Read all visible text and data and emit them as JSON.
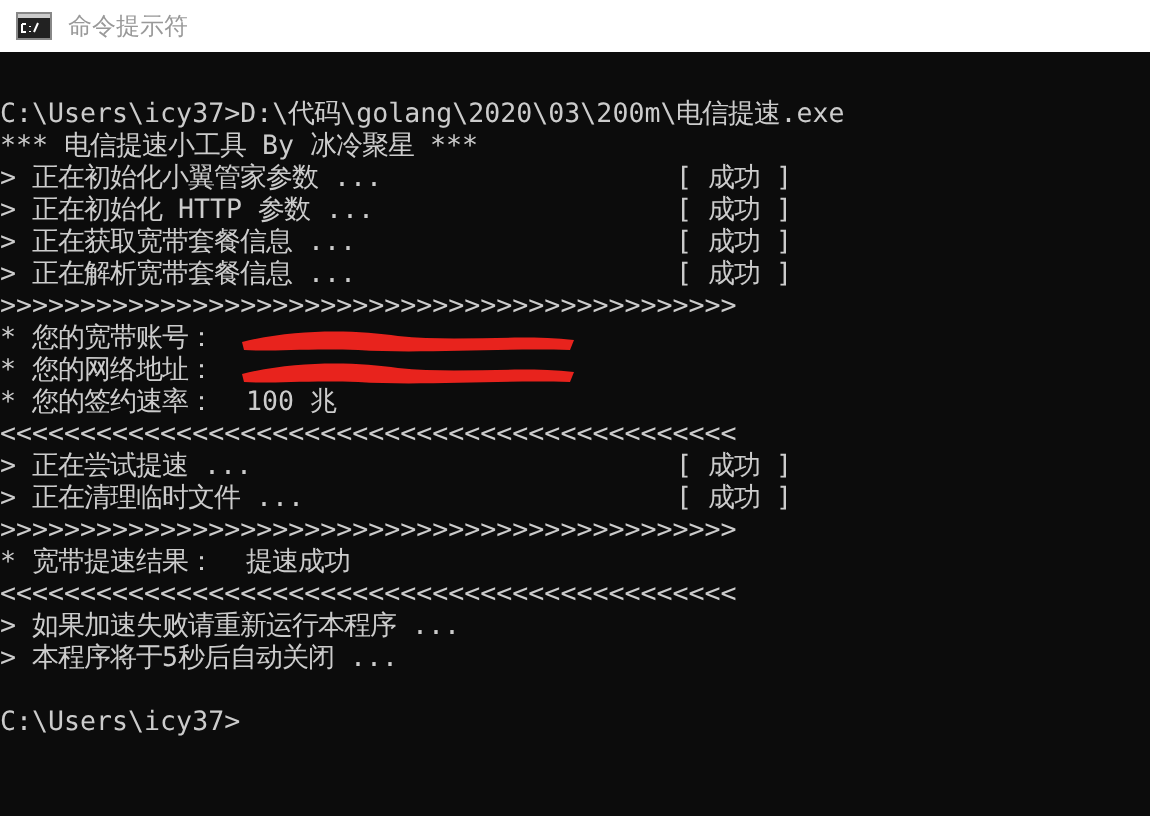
{
  "window": {
    "title": "命令提示符"
  },
  "console": {
    "lines": [
      {
        "kind": "plain"
      },
      {
        "kind": "plain",
        "text": "C:\\Users\\icy37>D:\\代码\\golang\\2020\\03\\200m\\电信提速.exe"
      },
      {
        "kind": "plain",
        "text": "*** 电信提速小工具 By 冰冷聚星 ***"
      },
      {
        "kind": "status",
        "text": "> 正在初始化小翼管家参数 ...",
        "status": "[ 成功 ]"
      },
      {
        "kind": "status",
        "text": "> 正在初始化 HTTP 参数 ...",
        "status": "[ 成功 ]"
      },
      {
        "kind": "status",
        "text": "> 正在获取宽带套餐信息 ...",
        "status": "[ 成功 ]"
      },
      {
        "kind": "status",
        "text": "> 正在解析宽带套餐信息 ...",
        "status": "[ 成功 ]"
      },
      {
        "kind": "plain",
        "text": ">>>>>>>>>>>>>>>>>>>>>>>>>>>>>>>>>>>>>>>>>>>>>>"
      },
      {
        "kind": "redacted",
        "text": "* 您的宽带账号："
      },
      {
        "kind": "redacted",
        "text": "* 您的网络地址："
      },
      {
        "kind": "plain",
        "text": "* 您的签约速率：  100 兆"
      },
      {
        "kind": "plain",
        "text": "<<<<<<<<<<<<<<<<<<<<<<<<<<<<<<<<<<<<<<<<<<<<<<"
      },
      {
        "kind": "status",
        "text": "> 正在尝试提速 ...",
        "status": "[ 成功 ]"
      },
      {
        "kind": "status",
        "text": "> 正在清理临时文件 ...",
        "status": "[ 成功 ]"
      },
      {
        "kind": "plain",
        "text": ">>>>>>>>>>>>>>>>>>>>>>>>>>>>>>>>>>>>>>>>>>>>>>"
      },
      {
        "kind": "plain",
        "text": "* 宽带提速结果：  提速成功"
      },
      {
        "kind": "plain",
        "text": "<<<<<<<<<<<<<<<<<<<<<<<<<<<<<<<<<<<<<<<<<<<<<<"
      },
      {
        "kind": "plain",
        "text": "> 如果加速失败请重新运行本程序 ..."
      },
      {
        "kind": "plain",
        "text": "> 本程序将于5秒后自动关闭 ..."
      },
      {
        "kind": "plain"
      },
      {
        "kind": "plain",
        "text": "C:\\Users\\icy37>"
      }
    ]
  }
}
